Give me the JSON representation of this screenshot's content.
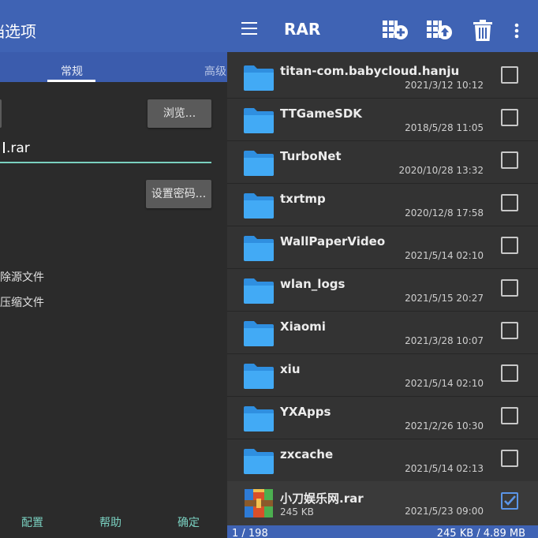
{
  "left": {
    "title": "档选项",
    "tabs": [
      "常规",
      "高级"
    ],
    "browse_label": "浏览...",
    "filename_value": ".rar",
    "password_label": "设置密码...",
    "options": [
      "除源文件",
      "压缩文件"
    ],
    "footer": [
      "配置",
      "帮助",
      "确定"
    ]
  },
  "right": {
    "title": "RAR",
    "toolbar_icons": [
      "archive-add-icon",
      "archive-extract-icon",
      "trash-icon",
      "more-vert-icon"
    ],
    "files": [
      {
        "name": "titan-com.babycloud.hanju",
        "date": "2021/3/12 10:12",
        "checked": false
      },
      {
        "name": "TTGameSDK",
        "date": "2018/5/28 11:05",
        "checked": false
      },
      {
        "name": "TurboNet",
        "date": "2020/10/28 13:32",
        "checked": false
      },
      {
        "name": "txrtmp",
        "date": "2020/12/8 17:58",
        "checked": false
      },
      {
        "name": "WallPaperVideo",
        "date": "2021/5/14 02:10",
        "checked": false
      },
      {
        "name": "wlan_logs",
        "date": "2021/5/15 20:27",
        "checked": false
      },
      {
        "name": "Xiaomi",
        "date": "2021/3/28 10:07",
        "checked": false
      },
      {
        "name": "xiu",
        "date": "2021/5/14 02:10",
        "checked": false
      },
      {
        "name": "YXApps",
        "date": "2021/2/26 10:30",
        "checked": false
      },
      {
        "name": "zxcache",
        "date": "2021/5/14 02:13",
        "checked": false
      }
    ],
    "archive": {
      "name": "小刀娱乐网.rar",
      "size": "245 KB",
      "date": "2021/5/23 09:00",
      "checked": true
    },
    "footer_count": "1 / 198",
    "footer_size": "245 KB / 4.89 MB"
  }
}
